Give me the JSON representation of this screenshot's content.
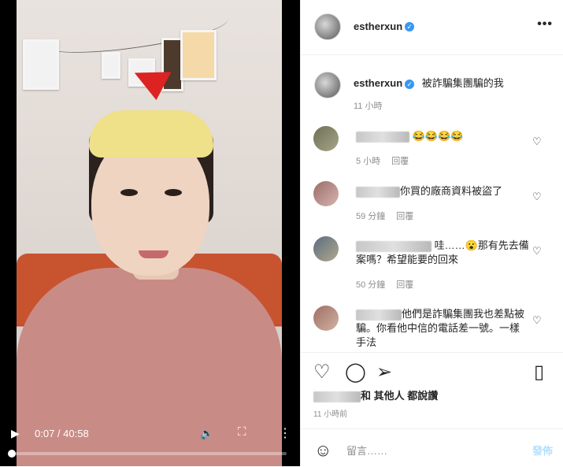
{
  "video": {
    "time": "0:07 / 40:58",
    "progress": 0.003
  },
  "header": {
    "username": "estherxun",
    "more_label": "•••"
  },
  "caption": {
    "username": "estherxun",
    "text": "被詐騙集團騙的我",
    "time": "11 小時"
  },
  "comments": [
    {
      "text": "😂😂😂😂",
      "time": "5 小時",
      "reply": "回覆"
    },
    {
      "text": "你買的廠商資料被盜了",
      "time": "59 分鐘",
      "reply": "回覆"
    },
    {
      "text": "哇……😮那有先去備案嗎？希望能要的回來",
      "time": "50 分鐘",
      "reply": "回覆"
    },
    {
      "text": "他們是詐騙集團我也差點被騙。你看他中信的電話差一號。一樣手法",
      "time": "",
      "reply": ""
    }
  ],
  "likes": {
    "suffix": "和 其他人 都說讚"
  },
  "posted_ago": "11 小時前",
  "add_comment": {
    "placeholder": "留言……",
    "post_label": "發佈"
  },
  "icons": {
    "play": "play-icon",
    "volume": "volume-icon",
    "fullscreen": "fullscreen-icon",
    "menu": "more-vertical-icon",
    "heart": "heart-icon",
    "comment": "comment-icon",
    "share": "share-icon",
    "save": "bookmark-icon",
    "emoji": "emoji-icon"
  }
}
